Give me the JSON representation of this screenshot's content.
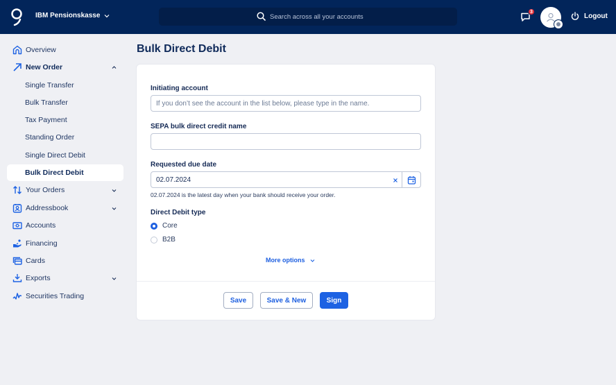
{
  "header": {
    "org_name": "IBM Pensionskasse",
    "search_placeholder": "Search across all your accounts",
    "messages_badge": "3",
    "logout_label": "Logout"
  },
  "sidebar": {
    "items": [
      {
        "label": "Overview",
        "icon": "home-icon"
      },
      {
        "label": "New Order",
        "icon": "arrow-up-right-icon",
        "expanded": true
      },
      {
        "label": "Single Transfer"
      },
      {
        "label": "Bulk Transfer"
      },
      {
        "label": "Tax Payment"
      },
      {
        "label": "Standing Order"
      },
      {
        "label": "Single Direct Debit"
      },
      {
        "label": "Bulk Direct Debit",
        "active": true
      },
      {
        "label": "Your Orders",
        "icon": "arrows-up-down-icon"
      },
      {
        "label": "Addressbook",
        "icon": "contact-card-icon"
      },
      {
        "label": "Accounts",
        "icon": "banknote-icon"
      },
      {
        "label": "Financing",
        "icon": "hand-coin-icon"
      },
      {
        "label": "Cards",
        "icon": "cards-icon"
      },
      {
        "label": "Exports",
        "icon": "download-icon"
      },
      {
        "label": "Securities Trading",
        "icon": "pulse-icon"
      }
    ]
  },
  "main": {
    "title": "Bulk Direct Debit",
    "form": {
      "initiating_account": {
        "label": "Initiating account",
        "value": "",
        "placeholder": "If you don’t see the account in the list below, please type in the name."
      },
      "sepa_name": {
        "label": "SEPA bulk direct credit name",
        "value": "",
        "placeholder": ""
      },
      "due_date": {
        "label": "Requested due date",
        "value": "02.07.2024",
        "hint": "02.07.2024 is the latest day when your bank should receive your order."
      },
      "debit_type": {
        "label": "Direct Debit type",
        "options": [
          {
            "label": "Core",
            "checked": true
          },
          {
            "label": "B2B",
            "checked": false
          }
        ]
      },
      "more_options_label": "More options"
    },
    "buttons": {
      "save": "Save",
      "save_new": "Save & New",
      "sign": "Sign"
    }
  },
  "colors": {
    "header_bg": "#02255a",
    "accent": "#1d62e3",
    "page_bg": "#eff0f4",
    "badge": "#e2313a"
  }
}
